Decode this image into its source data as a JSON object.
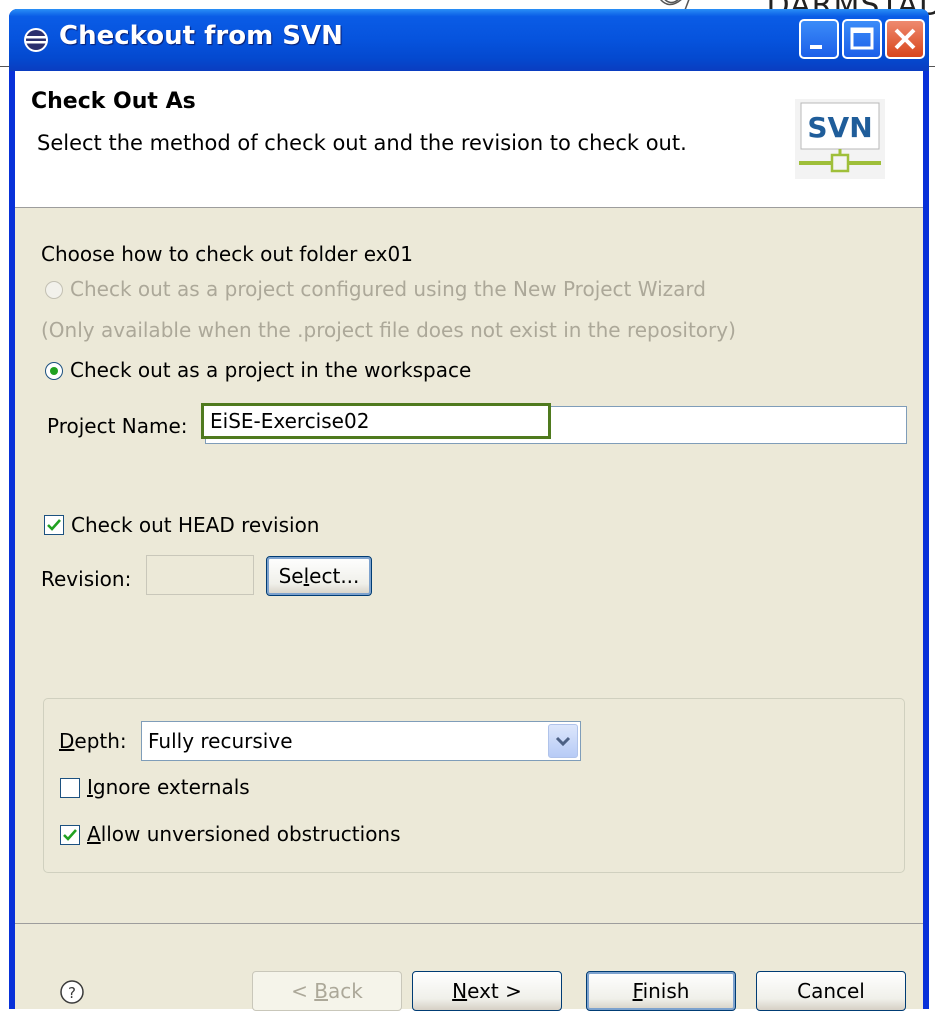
{
  "window": {
    "title": "Checkout from SVN"
  },
  "header": {
    "title": "Check Out As",
    "description": "Select the method of check out and the revision to check out.",
    "logo_text": "SVN"
  },
  "method": {
    "label": "Choose how to check out folder ex01",
    "option_wizard": "Check out as a project configured using the New Project Wizard",
    "option_wizard_note": "(Only available when the .project file does not exist in the repository)",
    "option_workspace": "Check out as a project in the workspace",
    "selected": "option_workspace"
  },
  "project": {
    "label": "Project Name:",
    "value": "EiSE-Exercise02"
  },
  "revision": {
    "head_checkbox_label": "Check out HEAD revision",
    "head_checked": true,
    "label": "Revision:",
    "value": "",
    "select_button": {
      "pre": "Se",
      "mnemonic": "l",
      "post": "ect..."
    }
  },
  "options": {
    "depth_label": {
      "mnemonic": "D",
      "post": "epth:"
    },
    "depth_value": "Fully recursive",
    "ignore_externals": {
      "mnemonic": "I",
      "post": "gnore externals",
      "checked": false
    },
    "allow_unversioned": {
      "mnemonic": "A",
      "post": "llow unversioned obstructions",
      "checked": true
    }
  },
  "buttons": {
    "back": {
      "pre": "< ",
      "mnemonic": "B",
      "post": "ack"
    },
    "next": {
      "mnemonic": "N",
      "post": "ext >"
    },
    "finish": {
      "mnemonic": "F",
      "post": "inish"
    },
    "cancel": "Cancel"
  },
  "background": {
    "corner_text": "DARMSTAD"
  },
  "colors": {
    "titlebar": "#0653dd",
    "client": "#ece9d8",
    "highlight_border": "#4f7a1e",
    "check": "#21a121"
  }
}
